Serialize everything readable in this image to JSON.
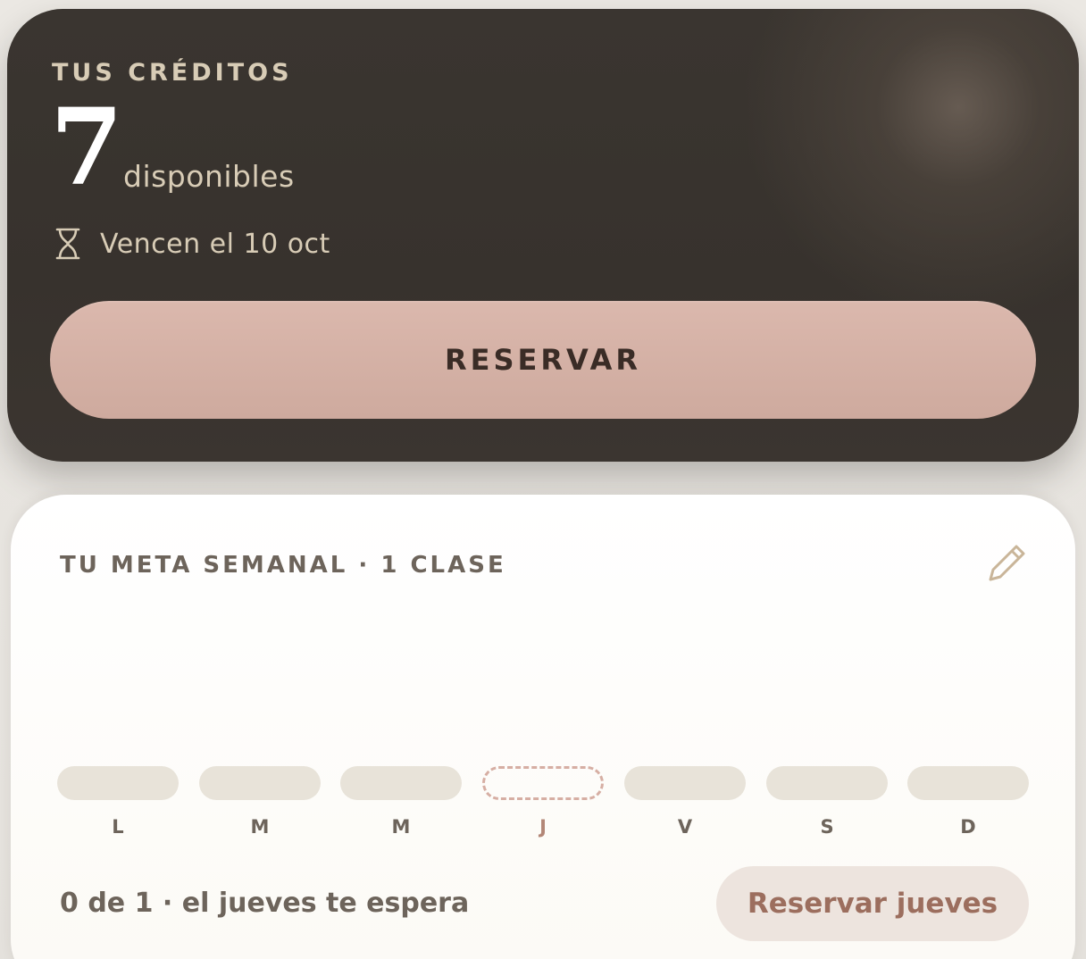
{
  "credits": {
    "label": "TUS CRÉDITOS",
    "count": "7",
    "count_suffix": "disponibles",
    "expiry_icon": "hourglass-icon",
    "expiry_text": "Vencen el 10 oct",
    "reserve_label": "RESERVAR"
  },
  "weekly_goal": {
    "title": "TU META SEMANAL · 1 CLASE",
    "edit_icon": "pencil-icon",
    "days": [
      {
        "letter": "L",
        "today": false
      },
      {
        "letter": "M",
        "today": false
      },
      {
        "letter": "M",
        "today": false
      },
      {
        "letter": "J",
        "today": true
      },
      {
        "letter": "V",
        "today": false
      },
      {
        "letter": "S",
        "today": false
      },
      {
        "letter": "D",
        "today": false
      }
    ],
    "progress_text": "0 de 1 · el jueves te espera",
    "reserve_day_label": "Reservar jueves"
  },
  "colors": {
    "card_dark": "#37322d",
    "accent_pink": "#d4b0a5",
    "text_muted": "#6d645b",
    "today_accent": "#b38777"
  }
}
